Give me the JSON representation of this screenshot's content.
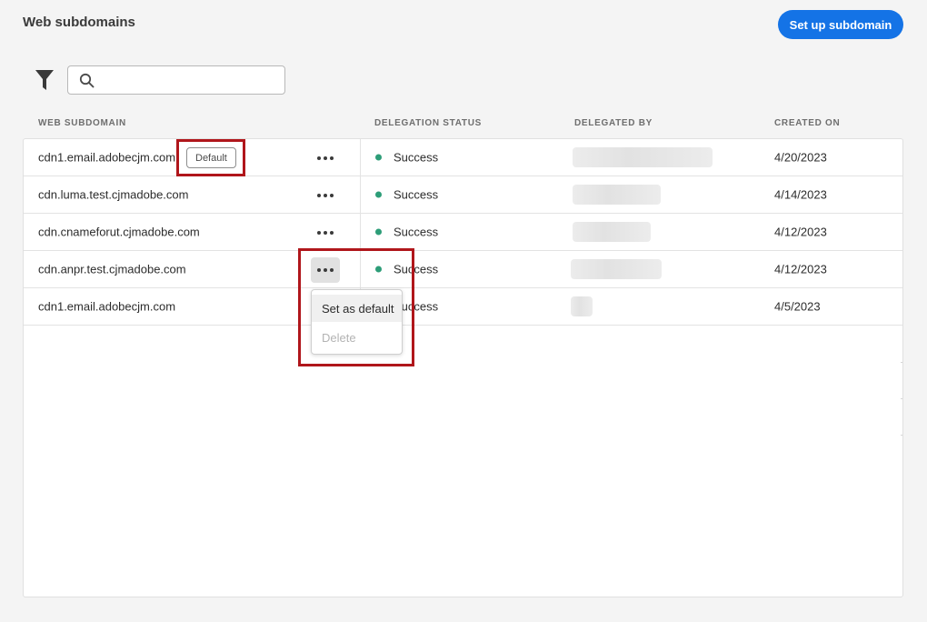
{
  "header": {
    "title": "Web subdomains",
    "primary_button": "Set up subdomain"
  },
  "toolbar": {
    "filter_icon": "filter-icon",
    "search": {
      "value": "",
      "placeholder": "",
      "icon": "search-icon"
    }
  },
  "table": {
    "columns": [
      "WEB SUBDOMAIN",
      "DELEGATION STATUS",
      "DELEGATED BY",
      "CREATED ON"
    ],
    "rows": [
      {
        "subdomain": "cdn1.email.adobecjm.com",
        "badge": "Default",
        "status": "Success",
        "created_on": "4/20/2023"
      },
      {
        "subdomain": "cdn.luma.test.cjmadobe.com",
        "badge": "",
        "status": "Success",
        "created_on": "4/14/2023"
      },
      {
        "subdomain": "cdn.cnameforut.cjmadobe.com",
        "badge": "",
        "status": "Success",
        "created_on": "4/12/2023"
      },
      {
        "subdomain": "cdn.anpr.test.cjmadobe.com",
        "badge": "",
        "status": "Success",
        "created_on": "4/12/2023"
      },
      {
        "subdomain": "cdn1.email.adobecjm.com",
        "badge": "",
        "status": "Success",
        "created_on": "4/5/2023"
      }
    ]
  },
  "context_menu": {
    "items": [
      "Set as default",
      "Delete"
    ],
    "disabled": [
      "Delete"
    ]
  },
  "colors": {
    "accent": "#1473e6",
    "success": "#2d9d78",
    "highlight": "#b0161b"
  }
}
